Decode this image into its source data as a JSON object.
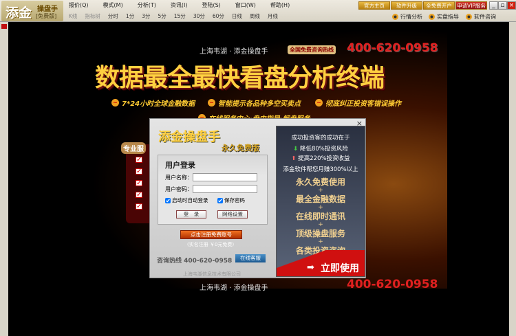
{
  "app": {
    "logo_text": "添金",
    "title": "操盘手",
    "edition": "[免费版]"
  },
  "menu": [
    "报价(Q)",
    "模式(M)",
    "分析(T)",
    "资讯(I)",
    "登陆(S)",
    "窗口(W)",
    "帮助(H)"
  ],
  "toolbar": {
    "items": [
      "K线",
      "指标树",
      "分时",
      "1分",
      "3分",
      "5分",
      "15分",
      "30分",
      "60分",
      "日线",
      "周线",
      "月线"
    ]
  },
  "top_links": [
    "官方主页",
    "软件升级",
    "全免费开户",
    "申请VIP服务"
  ],
  "qq_buttons": [
    "行情分析",
    "实盘指导",
    "软件咨询"
  ],
  "banner": {
    "company": "上海韦湖 · 添金操盘手",
    "hotline_label": "全国免费咨询热线",
    "phone": "400-620-0958",
    "headline": "数据最全最快看盘分析终端",
    "bullets": [
      "7*24小时全球金融数据",
      "智能提示各品种多空买卖点",
      "彻底纠正投资客错误操作",
      "在线服务中心·盘中指导·解盘服务"
    ],
    "side_label": "专业服"
  },
  "dialog": {
    "brand": "添金操盘手",
    "edition": "永久免费版",
    "login_title": "用户登录",
    "username_label": "用户名称：",
    "username_value": "",
    "password_label": "用户密码：",
    "password_value": "",
    "auto_login": "启动时自动登录",
    "auto_login_checked": true,
    "save_password": "保存密码",
    "save_password_checked": true,
    "login_btn": "登　录",
    "network_btn": "网络设置",
    "register_btn": "点击注册免费账号",
    "register_note": "(实名注册 ￥0元免费)",
    "hotline": "咨询热线 400-620-0958",
    "online_service": "在线客服",
    "company": "上海韦湖信息技术有限公司",
    "close": "×"
  },
  "promo": {
    "heading": "成功投资客的成功在于",
    "point1": "降低80%投资风险",
    "point2": "提高220%投资收益",
    "summary": "添金软件帮您月赚300%以上",
    "features": [
      "永久免费使用",
      "最全金融数据",
      "在线即时通讯",
      "顶级操盘服务",
      "各类投资咨询"
    ],
    "cta": "立即使用"
  }
}
